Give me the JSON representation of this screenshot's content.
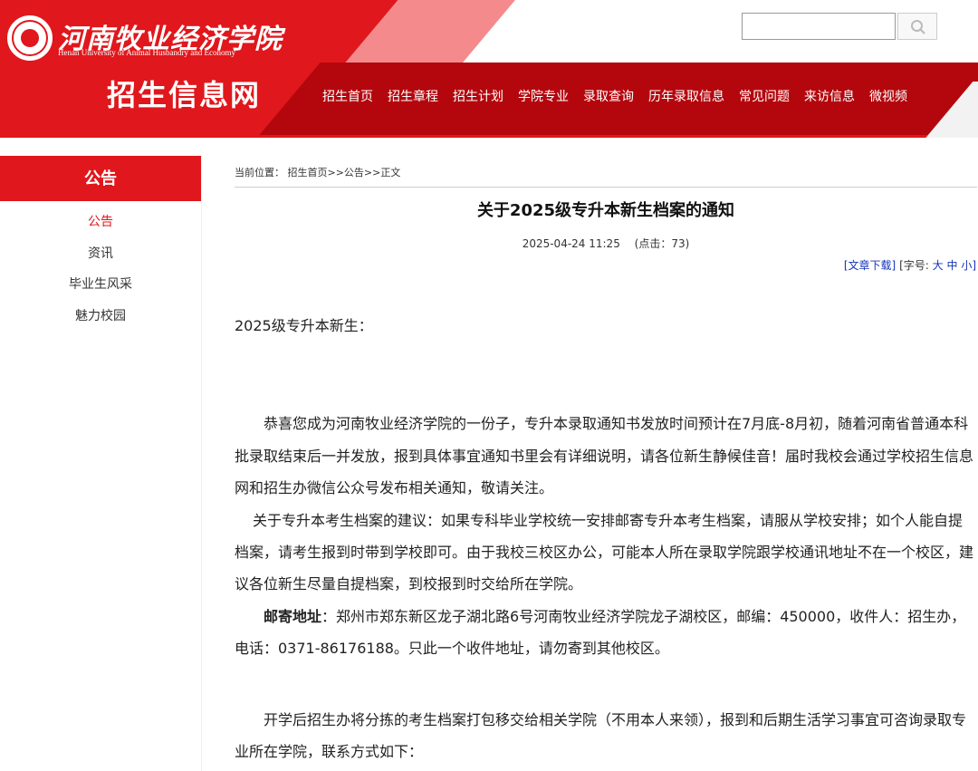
{
  "header": {
    "school_name_cn": "河南牧业经济学院",
    "school_name_en": "Henan University of Animal Husbandry and Economy",
    "site_title": "招生信息网",
    "search": {
      "value": "",
      "placeholder": ""
    },
    "nav": [
      "招生首页",
      "招生章程",
      "招生计划",
      "学院专业",
      "录取查询",
      "历年录取信息",
      "常见问题",
      "来访信息",
      "微视频"
    ]
  },
  "sidebar": {
    "title": "公告",
    "items": [
      "公告",
      "资讯",
      "毕业生风采",
      "魅力校园"
    ],
    "active_index": 0
  },
  "article": {
    "breadcrumb": {
      "label": "当前位置：",
      "path": "招生首页>>公告>>正文"
    },
    "title": "关于2025级专升本新生档案的通知",
    "datetime": "2025-04-24 11:25",
    "clicks_label": "(点击：",
    "clicks": "73",
    "clicks_close": ")",
    "download_label": "[文章下载]",
    "font_size_label": "[字号:",
    "font_large": "大",
    "font_medium": "中",
    "font_small": "小]",
    "greeting": "2025级专升本新生：",
    "para1": "恭喜您成为河南牧业经济学院的一份子，专升本录取通知书发放时间预计在7月底-8月初，随着河南省普通本科批录取结束后一并发放，报到具体事宜通知书里会有详细说明，请各位新生静候佳音！届时我校会通过学校招生信息网和招生办微信公众号发布相关通知，敬请关注。",
    "para2": "关于专升本考生档案的建议：如果专科毕业学校统一安排邮寄专升本考生档案，请服从学校安排；如个人能自提档案，请考生报到时带到学校即可。由于我校三校区办公，可能本人所在录取学院跟学校通讯地址不在一个校区，建议各位新生尽量自提档案，到校报到时交给所在学院。",
    "address_label": "邮寄地址",
    "address_text": "：郑州市郑东新区龙子湖北路6号河南牧业经济学院龙子湖校区，邮编：450000，收件人：招生办，电话：0371-86176188。只此一个收件地址，请勿寄到其他校区。",
    "para4": "开学后招生办将分拣的考生档案打包移交给相关学院（不用本人来领），报到和后期生活学习事宜可咨询录取专业所在学院，联系方式如下："
  },
  "colors": {
    "brand_red": "#e0171c",
    "dark_red": "#b4070d",
    "link_blue": "#1533b8"
  }
}
